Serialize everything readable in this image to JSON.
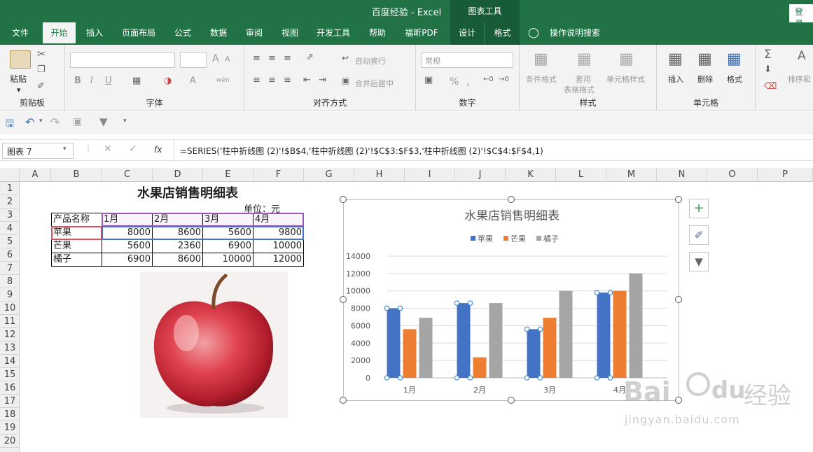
{
  "window": {
    "title": "百度经验  -  Excel",
    "context_tab": "图表工具",
    "login_label": "登录"
  },
  "tabs": [
    "文件",
    "开始",
    "插入",
    "页面布局",
    "公式",
    "数据",
    "审阅",
    "视图",
    "开发工具",
    "帮助",
    "福昕PDF",
    "设计",
    "格式"
  ],
  "tell_me": "操作说明搜索",
  "ribbon": {
    "clipboard": {
      "label": "剪贴板",
      "paste": "粘贴"
    },
    "font": {
      "label": "字体",
      "bold": "B",
      "italic": "I",
      "underline": "U",
      "grow": "A",
      "shrink": "A",
      "color": "A",
      "phonetic": "wén"
    },
    "alignment": {
      "label": "对齐方式",
      "wrap": "自动换行",
      "merge": "合并后居中"
    },
    "number": {
      "label": "数字",
      "format": "常规",
      "percent": "%",
      "comma": ","
    },
    "styles": {
      "label": "样式",
      "conditional": "条件格式",
      "table_line1": "套用",
      "table_line2": "表格格式",
      "cell_styles": "单元格样式"
    },
    "cells": {
      "label": "单元格",
      "insert": "插入",
      "delete": "删除",
      "format": "格式"
    },
    "editing": {
      "sort": "排序和"
    }
  },
  "formula_bar": {
    "name_box": "图表 7",
    "fx": "fx",
    "formula": "=SERIES('柱中折线图 (2)'!$B$4,'柱中折线图 (2)'!$C$3:$F$3,'柱中折线图 (2)'!$C$4:$F$4,1)"
  },
  "columns": [
    "A",
    "B",
    "C",
    "D",
    "E",
    "F",
    "G",
    "H",
    "I",
    "J",
    "K",
    "L",
    "M",
    "N",
    "O",
    "P"
  ],
  "rows": [
    "1",
    "2",
    "3",
    "4",
    "5",
    "6",
    "7",
    "8",
    "9",
    "10",
    "11",
    "12",
    "13",
    "14",
    "15",
    "16",
    "17",
    "18",
    "19",
    "20"
  ],
  "sheet": {
    "title": "水果店销售明细表",
    "unit": "单位：元",
    "headers": [
      "产品名称",
      "1月",
      "2月",
      "3月",
      "4月"
    ],
    "rows": [
      {
        "name": "苹果",
        "values": [
          "8000",
          "8600",
          "5600",
          "9800"
        ]
      },
      {
        "name": "芒果",
        "values": [
          "5600",
          "2360",
          "6900",
          "10000"
        ]
      },
      {
        "name": "橘子",
        "values": [
          "6900",
          "8600",
          "10000",
          "12000"
        ]
      }
    ]
  },
  "chart_data": {
    "type": "bar",
    "title": "水果店销售明细表",
    "categories": [
      "1月",
      "2月",
      "3月",
      "4月"
    ],
    "series": [
      {
        "name": "苹果",
        "values": [
          8000,
          8600,
          5600,
          9800
        ],
        "color": "#4472c4"
      },
      {
        "name": "芒果",
        "values": [
          5600,
          2360,
          6900,
          10000
        ],
        "color": "#ed7d31"
      },
      {
        "name": "橘子",
        "values": [
          6900,
          8600,
          10000,
          12000
        ],
        "color": "#a5a5a5"
      }
    ],
    "yticks": [
      "0",
      "2000",
      "4000",
      "6000",
      "8000",
      "10000",
      "12000",
      "14000"
    ],
    "ylim": [
      0,
      14000
    ],
    "grid": true,
    "legend": "top",
    "selected_series": "苹果"
  },
  "watermark": {
    "brand": "Bai",
    "brand2": "du",
    "word": "经验",
    "site": "jingyan.baidu.com"
  }
}
